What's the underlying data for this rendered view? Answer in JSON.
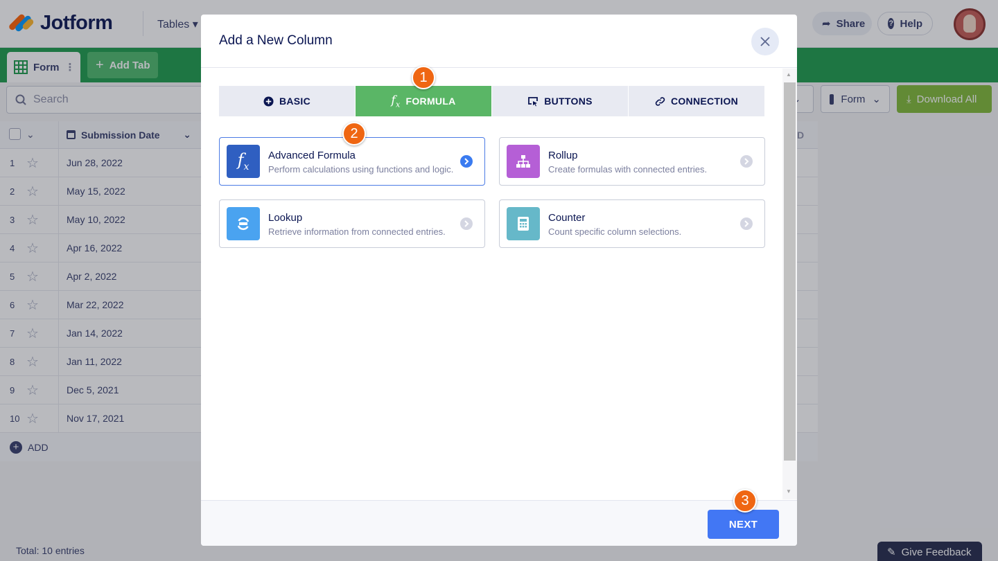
{
  "app": {
    "logo_text": "Jotform",
    "tables_menu": "Tables",
    "share_label": "Share",
    "help_label": "Help"
  },
  "tabbar": {
    "form_tab": "Form",
    "add_tab": "Add Tab"
  },
  "toolbar": {
    "search_placeholder": "Search",
    "form_select": "Form",
    "download_label": "Download All"
  },
  "grid": {
    "column_header": "Submission Date",
    "rows": [
      {
        "num": "1",
        "date": "Jun 28, 2022"
      },
      {
        "num": "2",
        "date": "May 15, 2022"
      },
      {
        "num": "3",
        "date": "May 10, 2022"
      },
      {
        "num": "4",
        "date": "Apr 16, 2022"
      },
      {
        "num": "5",
        "date": "Apr 2, 2022"
      },
      {
        "num": "6",
        "date": "Mar 22, 2022"
      },
      {
        "num": "7",
        "date": "Jan 14, 2022"
      },
      {
        "num": "8",
        "date": "Jan 11, 2022"
      },
      {
        "num": "9",
        "date": "Dec 5, 2021"
      },
      {
        "num": "10",
        "date": "Nov 17, 2021"
      }
    ],
    "add_label": "ADD",
    "partial_header": "D"
  },
  "footer": {
    "total": "Total: 10 entries",
    "feedback": "Give Feedback"
  },
  "modal": {
    "title": "Add a New Column",
    "tabs": [
      {
        "label": "BASIC"
      },
      {
        "label": "FORMULA"
      },
      {
        "label": "BUTTONS"
      },
      {
        "label": "CONNECTION"
      }
    ],
    "cards": [
      {
        "title": "Advanced Formula",
        "desc": "Perform calculations using functions and logic.",
        "color": "#2f5fc1"
      },
      {
        "title": "Rollup",
        "desc": "Create formulas with connected entries.",
        "color": "#b55fd6"
      },
      {
        "title": "Lookup",
        "desc": "Retrieve information from connected entries.",
        "color": "#4aa3f0"
      },
      {
        "title": "Counter",
        "desc": "Count specific column selections.",
        "color": "#66b8c9"
      }
    ],
    "next_label": "NEXT"
  },
  "steps": [
    "1",
    "2",
    "3"
  ],
  "colors": {
    "accent_green": "#5ab666",
    "tabbar_green": "#1b9b4b",
    "primary_blue": "#4277f4",
    "step_orange": "#ef6612"
  }
}
